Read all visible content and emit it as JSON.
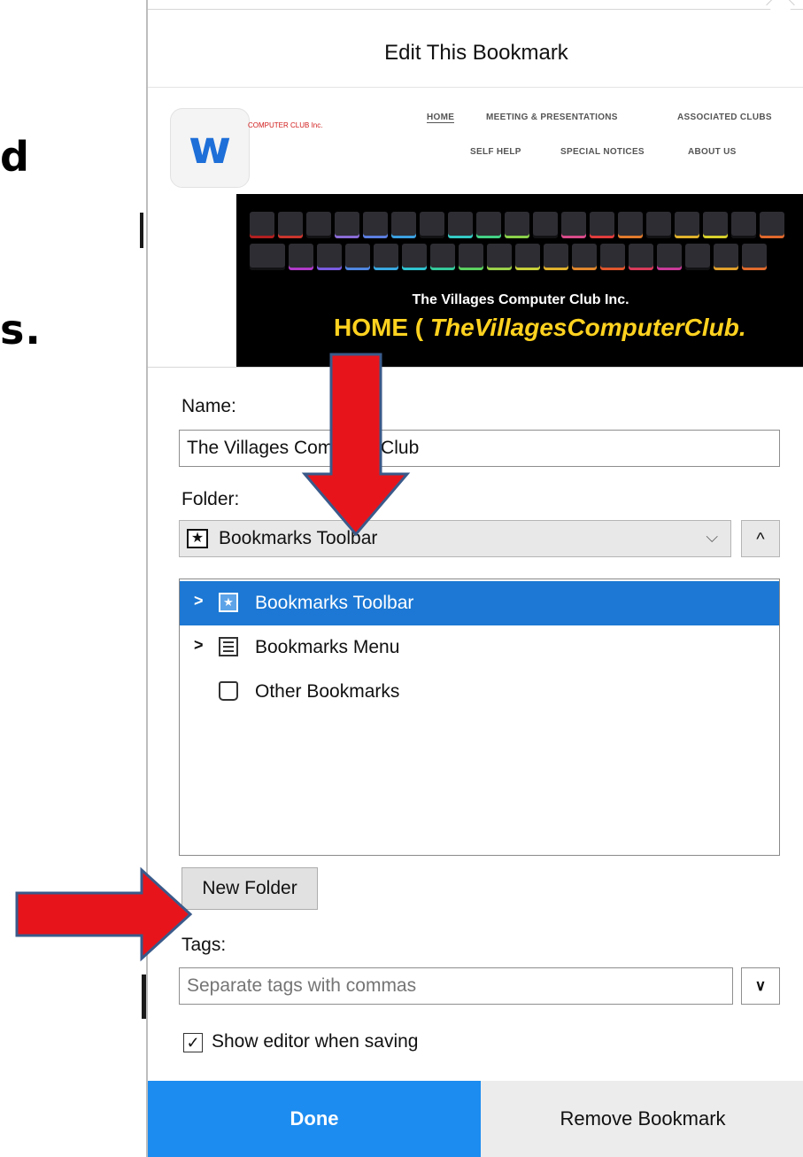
{
  "slide": {
    "line1": "d",
    "line2": "s."
  },
  "dialog": {
    "title": "Edit This Bookmark",
    "preview": {
      "site_name": "COMPUTER CLUB Inc.",
      "logo_letter": "w",
      "nav": [
        "HOME",
        "MEETING & PRESENTATIONS",
        "ASSOCIATED CLUBS",
        "SELF HELP",
        "SPECIAL NOTICES",
        "ABOUT US"
      ],
      "hero_subtitle": "The Villages Computer Club Inc.",
      "hero_title_prefix": "HOME ( ",
      "hero_title_emph": "TheVillagesComputerClub."
    },
    "name": {
      "label": "Name:",
      "value": "The Villages Computer Club"
    },
    "folder": {
      "label": "Folder:",
      "selected": "Bookmarks Toolbar",
      "collapse_glyph": "^",
      "tree": [
        {
          "label": "Bookmarks Toolbar",
          "selected": true,
          "icon": "star-folder-icon",
          "twisty": ">"
        },
        {
          "label": "Bookmarks Menu",
          "selected": false,
          "icon": "menu-list-icon",
          "twisty": ">"
        },
        {
          "label": "Other Bookmarks",
          "selected": false,
          "icon": "tray-icon",
          "twisty": ""
        }
      ]
    },
    "new_folder_label": "New Folder",
    "tags": {
      "label": "Tags:",
      "placeholder": "Separate tags with commas"
    },
    "show_editor": {
      "label": "Show editor when saving",
      "checked": true
    },
    "footer": {
      "done": "Done",
      "remove": "Remove Bookmark"
    },
    "colors": {
      "accent": "#1c8cf0",
      "selection": "#1c78d4",
      "annotation_arrow": "#e8141b"
    }
  }
}
